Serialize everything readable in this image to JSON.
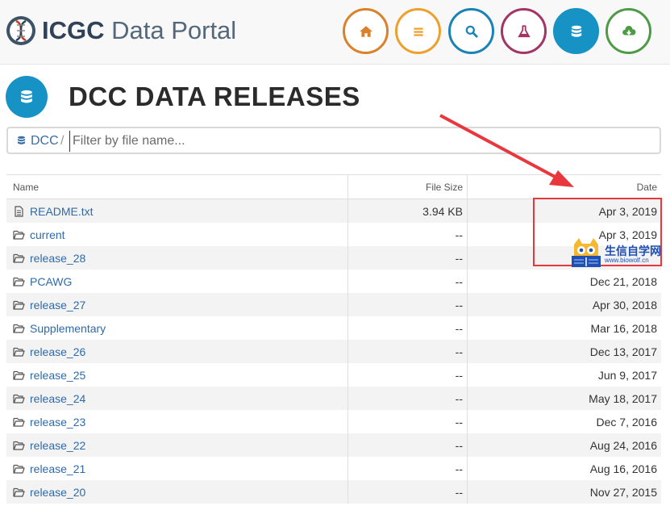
{
  "header": {
    "brand_bold": "ICGC",
    "brand_rest": " Data Portal",
    "nav": [
      {
        "icon": "home-icon",
        "color": "#d9822b"
      },
      {
        "icon": "list-icon",
        "color": "#eda02b"
      },
      {
        "icon": "search-icon",
        "color": "#1a83b5"
      },
      {
        "icon": "flask-icon",
        "color": "#a33465"
      },
      {
        "icon": "database-icon",
        "color": "#1693c4",
        "active": true
      },
      {
        "icon": "cloud-download-icon",
        "color": "#4e9a45"
      }
    ]
  },
  "page": {
    "title": "DCC DATA RELEASES"
  },
  "filter": {
    "breadcrumb": "DCC",
    "separator": "/",
    "placeholder": "Filter by file name..."
  },
  "table": {
    "columns": [
      "Name",
      "File Size",
      "Date"
    ],
    "rows": [
      {
        "type": "file",
        "name": "README.txt",
        "size": "3.94 KB",
        "date": "Apr 3, 2019"
      },
      {
        "type": "folder",
        "name": "current",
        "size": "--",
        "date": "Apr 3, 2019"
      },
      {
        "type": "folder",
        "name": "release_28",
        "size": "--",
        "date": ""
      },
      {
        "type": "folder",
        "name": "PCAWG",
        "size": "--",
        "date": "Dec 21, 2018"
      },
      {
        "type": "folder",
        "name": "release_27",
        "size": "--",
        "date": "Apr 30, 2018"
      },
      {
        "type": "folder",
        "name": "Supplementary",
        "size": "--",
        "date": "Mar 16, 2018"
      },
      {
        "type": "folder",
        "name": "release_26",
        "size": "--",
        "date": "Dec 13, 2017"
      },
      {
        "type": "folder",
        "name": "release_25",
        "size": "--",
        "date": "Jun 9, 2017"
      },
      {
        "type": "folder",
        "name": "release_24",
        "size": "--",
        "date": "May 18, 2017"
      },
      {
        "type": "folder",
        "name": "release_23",
        "size": "--",
        "date": "Dec 7, 2016"
      },
      {
        "type": "folder",
        "name": "release_22",
        "size": "--",
        "date": "Aug 24, 2016"
      },
      {
        "type": "folder",
        "name": "release_21",
        "size": "--",
        "date": "Aug 16, 2016"
      },
      {
        "type": "folder",
        "name": "release_20",
        "size": "--",
        "date": "Nov 27, 2015"
      }
    ]
  },
  "annotation": {
    "color": "#e8383d"
  },
  "watermark": {
    "text": "生信自学网",
    "url": "www.biowolf.cn"
  }
}
